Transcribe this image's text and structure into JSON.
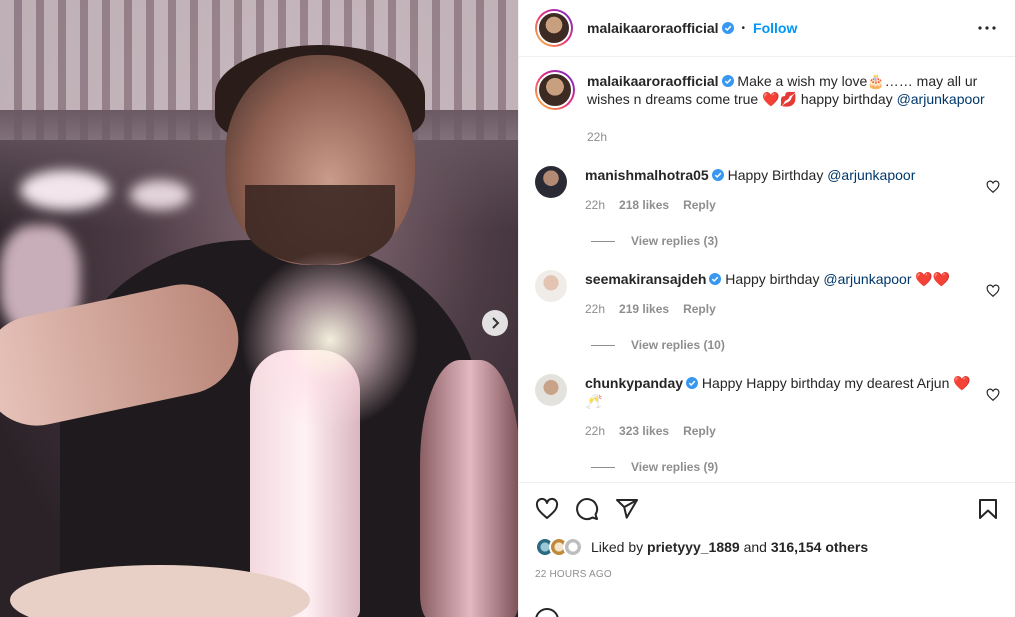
{
  "post": {
    "author": "malaikaaroraofficial",
    "dot": "•",
    "follow_label": "Follow",
    "caption_text": "Make a wish my love🎂…… may all ur wishes n dreams come true ❤️💋 happy birthday",
    "caption_mention": "@arjunkapoor",
    "caption_time": "22h"
  },
  "comments": [
    {
      "user": "manishmalhotra05",
      "text": "Happy Birthday",
      "mention": "@arjunkapoor",
      "time": "22h",
      "likes": "218 likes",
      "reply": "Reply",
      "view_replies": "View replies (3)"
    },
    {
      "user": "seemakiransajdeh",
      "text": "Happy birthday",
      "mention": "@arjunkapoor",
      "suffix": "❤️❤️",
      "time": "22h",
      "likes": "219 likes",
      "reply": "Reply",
      "view_replies": "View replies (10)"
    },
    {
      "user": "chunkypanday",
      "text": "Happy Happy birthday my dearest Arjun ❤️ 🥂",
      "time": "22h",
      "likes": "323 likes",
      "reply": "Reply",
      "view_replies": "View replies (9)"
    }
  ],
  "likes": {
    "prefix": "Liked by",
    "user": "prietyyy_1889",
    "middle": "and",
    "count": "316,154 others"
  },
  "timestamp": "22 HOURS AGO",
  "colors": {
    "accent": "#0095f6",
    "mention": "#00376b",
    "verified": "#3897f0",
    "secondary_text": "#8e8e8e"
  },
  "icons": {
    "like": "heart-icon",
    "comment": "comment-icon",
    "share": "share-icon",
    "save": "bookmark-icon",
    "more": "more-options-icon",
    "next": "chevron-right-icon"
  }
}
